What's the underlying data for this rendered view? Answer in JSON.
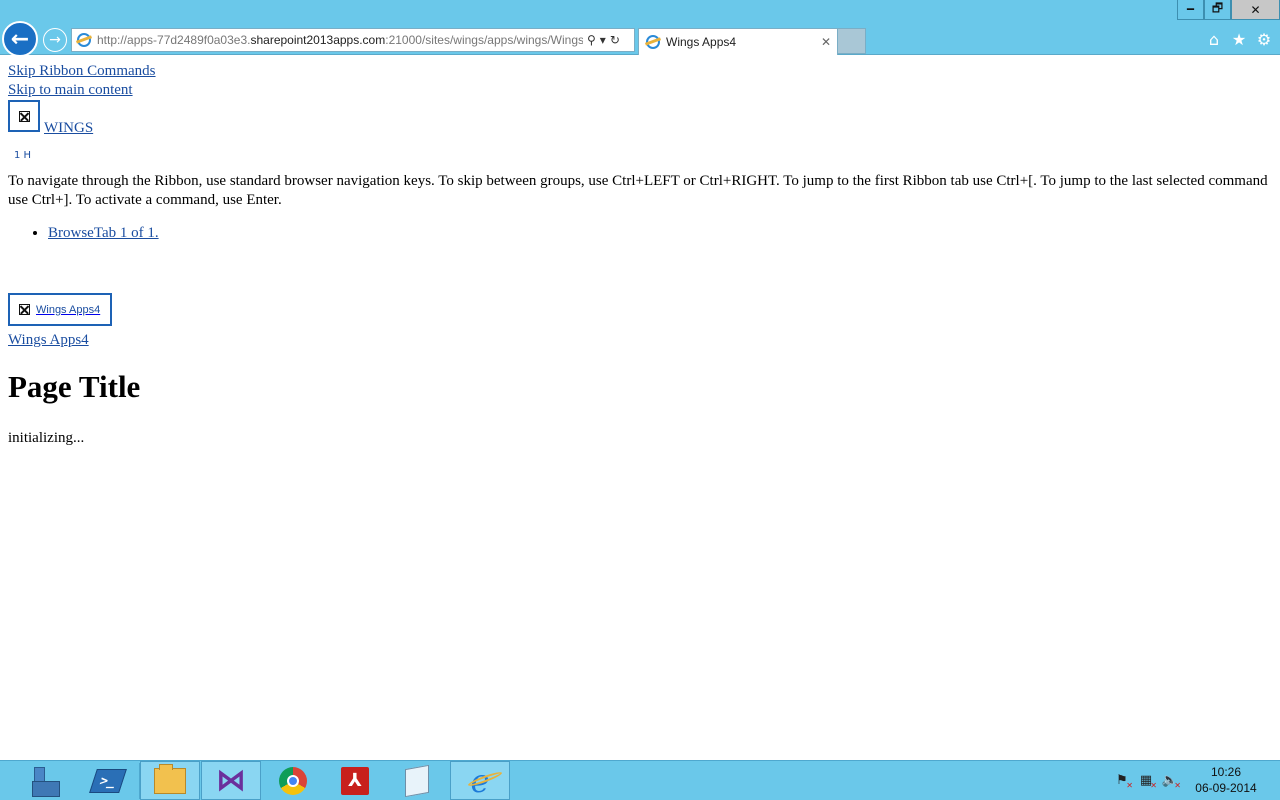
{
  "browser": {
    "window_controls": {
      "minimize": "🗕",
      "restore": "🗗",
      "close": "✕"
    },
    "back_glyph": "←",
    "forward_glyph": "→",
    "address_bar": {
      "url_prefix": "http://apps-77d2489f0a03e3.",
      "url_domain": "sharepoint2013apps.com",
      "url_suffix": ":21000/sites/wings/apps/wings/Wings",
      "search_glyph": "⚲",
      "dropdown_glyph": "▾",
      "refresh_glyph": "↻"
    },
    "active_tab": {
      "title": "Wings Apps4",
      "close_glyph": "✕"
    },
    "toolbar": {
      "home": "⌂",
      "favorites": "★",
      "settings": "⚙"
    }
  },
  "page": {
    "skip_ribbon": "Skip Ribbon Commands",
    "skip_main": "Skip to main content",
    "site_name": "WINGS",
    "glyphs": "1 H",
    "ribbon_help": "To navigate through the Ribbon, use standard browser navigation keys. To skip between groups, use Ctrl+LEFT or Ctrl+RIGHT. To jump to the first Ribbon tab use Ctrl+[. To jump to the last selected command use Ctrl+]. To activate a command, use Enter.",
    "ribbon_tabs": [
      "BrowseTab 1 of 1."
    ],
    "app_logo_text": "Wings Apps4",
    "app_title_link": "Wings Apps4",
    "page_title": "Page Title",
    "status": "initializing..."
  },
  "taskbar": {
    "apps": [
      "server-manager",
      "powershell",
      "file-explorer",
      "visual-studio",
      "chrome",
      "acrobat",
      "notepad",
      "internet-explorer"
    ],
    "active_app": "internet-explorer",
    "tray": {
      "flag": "⚑",
      "network": "▦",
      "volume": "🔈"
    },
    "clock": {
      "time": "10:26",
      "date": "06-09-2014"
    }
  },
  "colors": {
    "chrome_bg": "#6ac8ea",
    "link": "#1a4da0",
    "logo_border": "#1d62b5",
    "back_button": "#1a6fc4"
  }
}
